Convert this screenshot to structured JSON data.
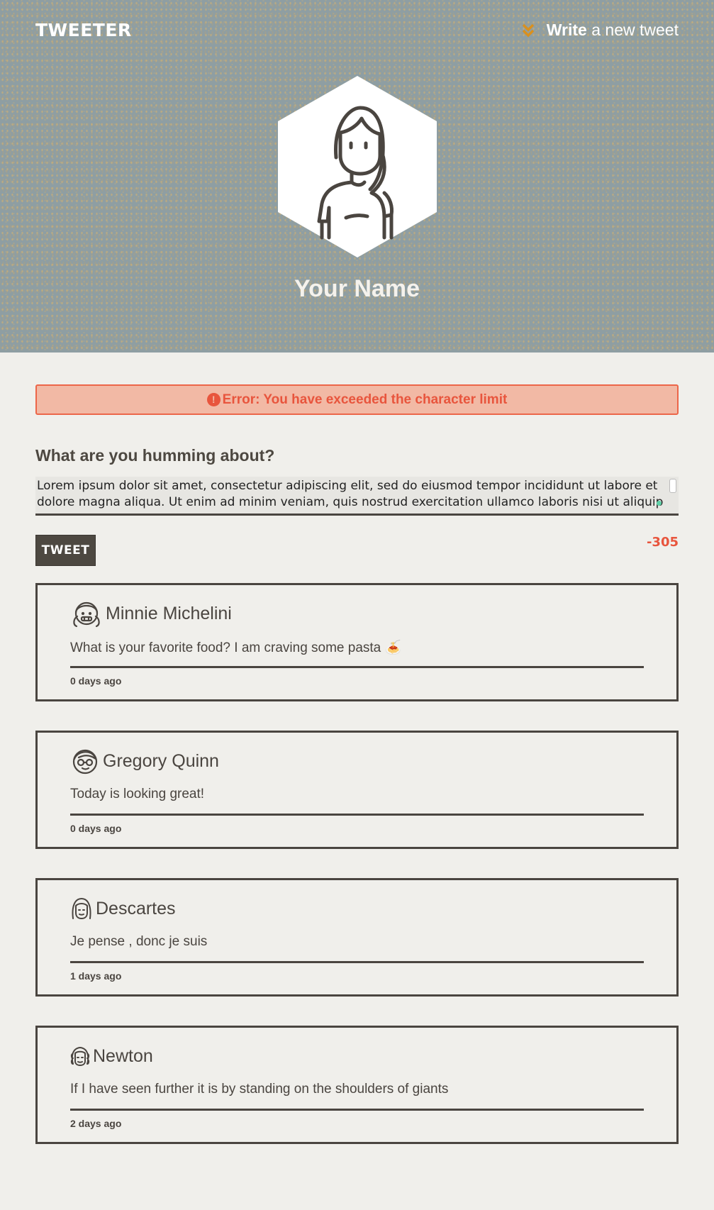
{
  "header": {
    "logo": "TWEETER",
    "write_bold": "Write",
    "write_rest": "a new tweet",
    "profile_name": "Your Name"
  },
  "error": {
    "message": "Error: You have exceeded the character limit"
  },
  "compose": {
    "prompt": "What are you humming about?",
    "text": "Lorem ipsum dolor sit amet, consectetur adipiscing elit, sed do eiusmod tempor incididunt ut labore et dolore magna aliqua. Ut enim ad minim veniam, quis nostrud exercitation ullamco laboris nisi ut aliquip",
    "button_label": "TWEET",
    "counter": "-305"
  },
  "tweets": [
    {
      "name": "Minnie Michelini",
      "body": "What is your favorite food? I am craving some pasta 🍝",
      "time": "0 days ago",
      "avatar": "girl-pigtails-icon"
    },
    {
      "name": "Gregory Quinn",
      "body": "Today is looking great!",
      "time": "0 days ago",
      "avatar": "boy-glasses-icon"
    },
    {
      "name": "Descartes",
      "body": "Je pense , donc je suis",
      "time": "1 days ago",
      "avatar": "long-hair-icon"
    },
    {
      "name": "Newton",
      "body": "If I have seen further it is by standing on the shoulders of giants",
      "time": "2 days ago",
      "avatar": "curly-wig-icon"
    }
  ],
  "colors": {
    "header_bg": "#8e9ea3",
    "page_bg": "#f0efeb",
    "error": "#e8553d",
    "dark": "#4a4540",
    "accent_chevron": "#d9901e"
  }
}
